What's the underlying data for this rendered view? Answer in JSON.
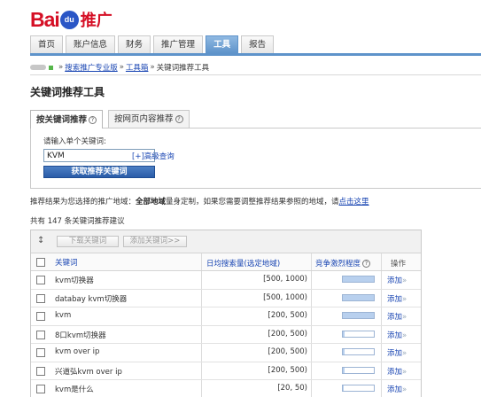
{
  "logo": {
    "text_left": "Bai",
    "text_paw": "du",
    "text_right": "推广"
  },
  "top_tabs": [
    {
      "label": "首页",
      "active": false
    },
    {
      "label": "账户信息",
      "active": false
    },
    {
      "label": "财务",
      "active": false
    },
    {
      "label": "推广管理",
      "active": false
    },
    {
      "label": "工具",
      "active": true
    },
    {
      "label": "报告",
      "active": false
    }
  ],
  "breadcrumb": {
    "crumb1": "搜索推广专业版",
    "sep": "»",
    "crumb2": "工具箱",
    "current": "关键词推荐工具"
  },
  "page_title": "关键词推荐工具",
  "sub_tabs": [
    {
      "label": "按关键词推荐",
      "active": true
    },
    {
      "label": "按网页内容推荐",
      "active": false
    }
  ],
  "query": {
    "label": "请输入单个关键词:",
    "value": "KVM",
    "advanced_link": "[+]高级查询",
    "submit_label": "获取推荐关键词"
  },
  "info": {
    "prefix": "推荐结果为您选择的推广地域：",
    "region": "全部地域",
    "middle": "量身定制，如果您需要调整推荐结果参照的地域，请",
    "link": "点击这里"
  },
  "count_text": "共有 147 条关键词推荐建议",
  "toolbar": {
    "sort_glyph": "↕",
    "download_label": "下载关键词",
    "add_label": "添加关键词>>"
  },
  "table": {
    "header": {
      "keyword": "关键词",
      "volume": "日均搜索量(选定地域)",
      "competition": "竞争激烈程度",
      "operation": "操作"
    },
    "add_link_label": "添加",
    "add_link_arrow": "»",
    "rows": [
      {
        "keyword": "kvm切换器",
        "volume": "[500, 1000)",
        "competition": 1.0
      },
      {
        "keyword": "databay kvm切换器",
        "volume": "[500, 1000)",
        "competition": 1.0
      },
      {
        "keyword": "kvm",
        "volume": "[200, 500)",
        "competition": 1.0
      },
      {
        "keyword": "8口kvm切换器",
        "volume": "[200, 500)",
        "competition": 0.06
      },
      {
        "keyword": "kvm over ip",
        "volume": "[200, 500)",
        "competition": 0.06
      },
      {
        "keyword": "兴道弘kvm over ip",
        "volume": "[200, 500)",
        "competition": 0.06
      },
      {
        "keyword": "kvm是什么",
        "volume": "[20, 50)",
        "competition": 0.04
      }
    ]
  }
}
